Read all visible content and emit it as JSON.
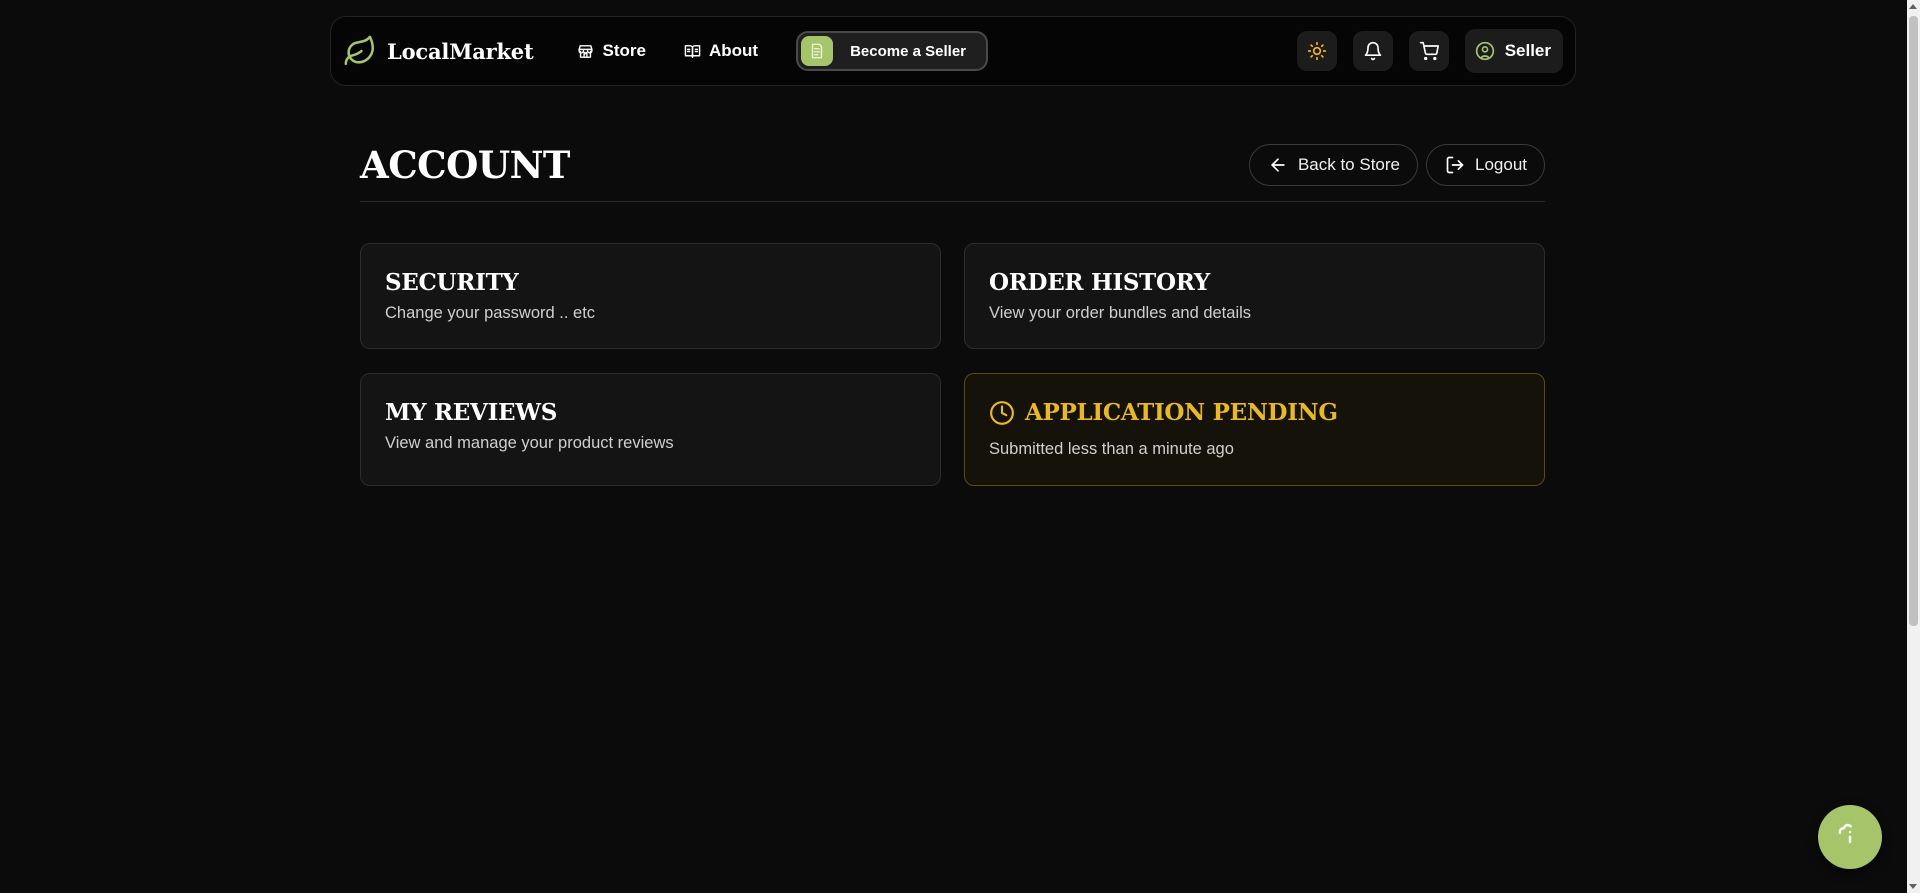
{
  "header": {
    "brand": "LocalMarket",
    "nav": [
      {
        "label": "Store",
        "icon": "store-icon"
      },
      {
        "label": "About",
        "icon": "book-icon"
      }
    ],
    "cta_label": "Become a Seller",
    "user_label": "Seller"
  },
  "page": {
    "title": "ACCOUNT",
    "back_label": "Back to Store",
    "logout_label": "Logout"
  },
  "cards": {
    "security": {
      "title": "SECURITY",
      "desc": "Change your password .. etc"
    },
    "orders": {
      "title": "ORDER HISTORY",
      "desc": "View your order bundles and details"
    },
    "reviews": {
      "title": "MY REVIEWS",
      "desc": "View and manage your product reviews"
    },
    "application": {
      "title": "APPLICATION PENDING",
      "desc": "Submitted less than a minute ago"
    }
  },
  "colors": {
    "background": "#0b0b0b",
    "accent_green": "#a6c46a",
    "pending_amber": "#e8b825",
    "sun_icon": "#f0b429"
  }
}
